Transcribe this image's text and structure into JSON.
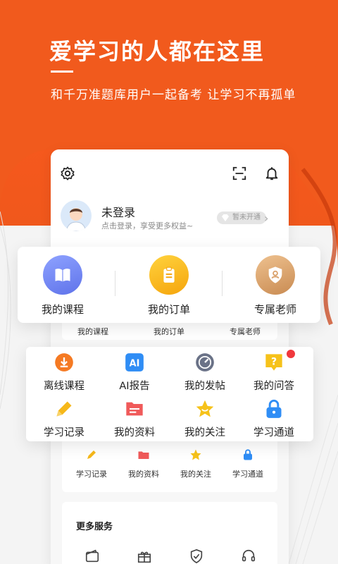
{
  "hero": {
    "title": "爱学习的人都在这里",
    "subtitle": "和千万准题库用户一起备考 让学习不再孤单"
  },
  "header_icons": [
    "settings-icon",
    "scan-icon",
    "bell-icon"
  ],
  "profile": {
    "title": "未登录",
    "subtitle": "点击登录，享受更多权益~",
    "vip_badge": "暂未开通"
  },
  "main_shortcuts": [
    {
      "label": "我的课程",
      "icon": "book-icon",
      "color": "#6f86f5"
    },
    {
      "label": "我的订单",
      "icon": "clipboard-icon",
      "color": "#f9b51a"
    },
    {
      "label": "专属老师",
      "icon": "teacher-shield-icon",
      "color": "#d9a06a"
    }
  ],
  "mini_shortcuts": [
    "我的课程",
    "我的订单",
    "专属老师"
  ],
  "grid_items": [
    {
      "label": "离线课程",
      "icon": "download-icon",
      "color": "#f57a23"
    },
    {
      "label": "AI报告",
      "icon": "ai-icon",
      "color": "#2f8df5"
    },
    {
      "label": "我的发帖",
      "icon": "gauge-icon",
      "color": "#6a7287"
    },
    {
      "label": "我的问答",
      "icon": "question-icon",
      "color": "#f6c21a"
    },
    {
      "label": "学习记录",
      "icon": "pencil-icon",
      "color": "#f6b81a"
    },
    {
      "label": "我的资料",
      "icon": "folder-icon",
      "color": "#f05a5a"
    },
    {
      "label": "我的关注",
      "icon": "star-icon",
      "color": "#f6c21a"
    },
    {
      "label": "学习通道",
      "icon": "lock-icon",
      "color": "#2f8df5"
    }
  ],
  "mini_grid": [
    "学习记录",
    "我的资料",
    "我的关注",
    "学习通道"
  ],
  "more_services": {
    "title": "更多服务",
    "icons": [
      "wallet-icon",
      "gift-icon",
      "shield-check-icon",
      "headset-icon"
    ]
  },
  "colors": {
    "brand": "#f0581c",
    "notification_dot": "#f0383d"
  }
}
